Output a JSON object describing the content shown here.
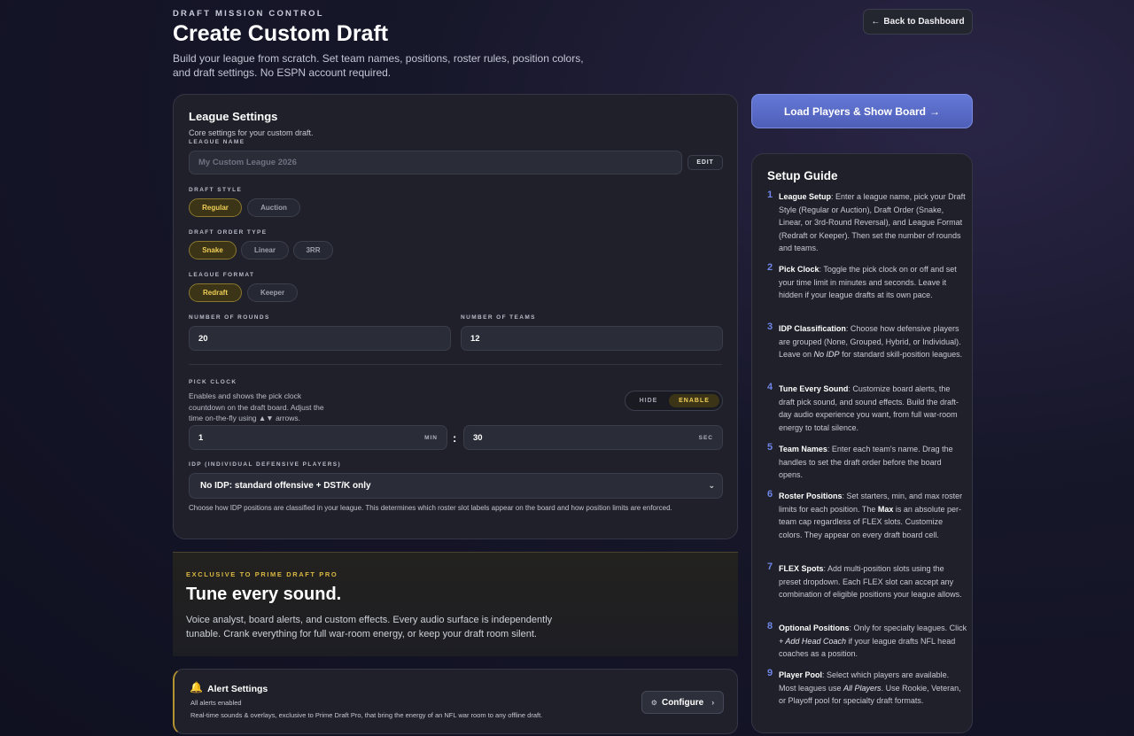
{
  "header": {
    "eyebrow": "DRAFT MISSION CONTROL",
    "title": "Create Custom Draft",
    "subtitle": "Build your league from scratch. Set team names, positions, roster rules, position colors, and draft settings. No ESPN account required.",
    "back_label": "Back to Dashboard",
    "back_icon": "←"
  },
  "settings": {
    "title": "League Settings",
    "subtitle": "Core settings for your custom draft.",
    "league_name": {
      "label": "LEAGUE NAME",
      "placeholder": "My Custom League 2026",
      "edit_label": "EDIT"
    },
    "draft_style": {
      "label": "DRAFT STYLE",
      "options": [
        "Regular",
        "Auction"
      ],
      "selected": "Regular"
    },
    "draft_order": {
      "label": "DRAFT ORDER TYPE",
      "options": [
        "Snake",
        "Linear",
        "3RR"
      ],
      "selected": "Snake"
    },
    "league_format": {
      "label": "LEAGUE FORMAT",
      "options": [
        "Redraft",
        "Keeper"
      ],
      "selected": "Redraft"
    },
    "rounds": {
      "label": "NUMBER OF ROUNDS",
      "value": "20"
    },
    "teams": {
      "label": "NUMBER OF TEAMS",
      "value": "12"
    },
    "pick_clock": {
      "label": "PICK CLOCK",
      "description": "Enables and shows the pick clock countdown on the draft board. Adjust the time on-the-fly using ▲▼ arrows.",
      "toggle_off": "HIDE",
      "toggle_on": "ENABLE",
      "toggle_state": "ENABLE",
      "minutes": "1",
      "min_unit": "MIN",
      "seconds": "30",
      "sec_unit": "SEC",
      "separator": ":"
    },
    "idp": {
      "label": "IDP (INDIVIDUAL DEFENSIVE PLAYERS)",
      "selected": "No IDP: standard offensive + DST/K only",
      "help": "Choose how IDP positions are classified in your league. This determines which roster slot labels appear on the board and how position limits are enforced."
    }
  },
  "promo": {
    "eyebrow": "EXCLUSIVE TO PRIME DRAFT PRO",
    "title": "Tune every sound.",
    "description": "Voice analyst, board alerts, and custom effects. Every audio surface is independently tunable. Crank everything for full war-room energy, or keep your draft room silent."
  },
  "alerts": {
    "icon": "bell-icon",
    "title": "Alert Settings",
    "status": "All alerts enabled",
    "description": "Real-time sounds & overlays, exclusive to Prime Draft Pro, that bring the energy of an NFL war room to any offline draft.",
    "configure_label": "Configure",
    "configure_icon": "gear-icon"
  },
  "load_button": {
    "label": "Load Players & Show Board",
    "icon": "→"
  },
  "guide": {
    "title": "Setup Guide",
    "steps": [
      {
        "num": "1",
        "title": "League Setup",
        "text": "Enter a league name, pick your Draft Style (Regular or Auction), Draft Order (Snake, Linear, or 3rd-Round Reversal), and League Format (Redraft or Keeper). Then set the number of rounds and teams."
      },
      {
        "num": "2",
        "title": "Pick Clock",
        "text": "Toggle the pick clock on or off and set your time limit in minutes and seconds. Leave it hidden if your league drafts at its own pace."
      },
      {
        "num": "3",
        "title": "IDP Classification",
        "text_a": "Choose how defensive players are grouped (None, Grouped, Hybrid, or Individual). Leave on ",
        "em": "No IDP",
        "text_b": " for standard skill-position leagues."
      },
      {
        "num": "4",
        "title": "Tune Every Sound",
        "text": "Customize board alerts, the draft pick sound, and sound effects. Build the draft-day audio experience you want, from full war-room energy to total silence."
      },
      {
        "num": "5",
        "title": "Team Names",
        "text": "Enter each team's name. Drag the handles to set the draft order before the board opens."
      },
      {
        "num": "6",
        "title": "Roster Positions",
        "text_a": "Set starters, min, and max roster limits for each position. The ",
        "strong": "Max",
        "text_b": " is an absolute per-team cap regardless of FLEX slots. Customize colors. They appear on every draft board cell."
      },
      {
        "num": "7",
        "title": "FLEX Spots",
        "text": "Add multi-position slots using the preset dropdown. Each FLEX slot can accept any combination of eligible positions your league allows."
      },
      {
        "num": "8",
        "title": "Optional Positions",
        "text_a": "Only for specialty leagues. Click ",
        "em": "+ Add Head Coach",
        "text_b": " if your league drafts NFL head coaches as a position."
      },
      {
        "num": "9",
        "title": "Player Pool",
        "text_a": "Select which players are available. Most leagues use ",
        "em": "All Players",
        "text_b": ". Use Rookie, Veteran, or Playoff pool for specialty draft formats."
      }
    ]
  },
  "colors": {
    "accent_gold": "#f0cf55",
    "accent_blue": "#6f86e8",
    "card_bg": "#1f2029"
  }
}
